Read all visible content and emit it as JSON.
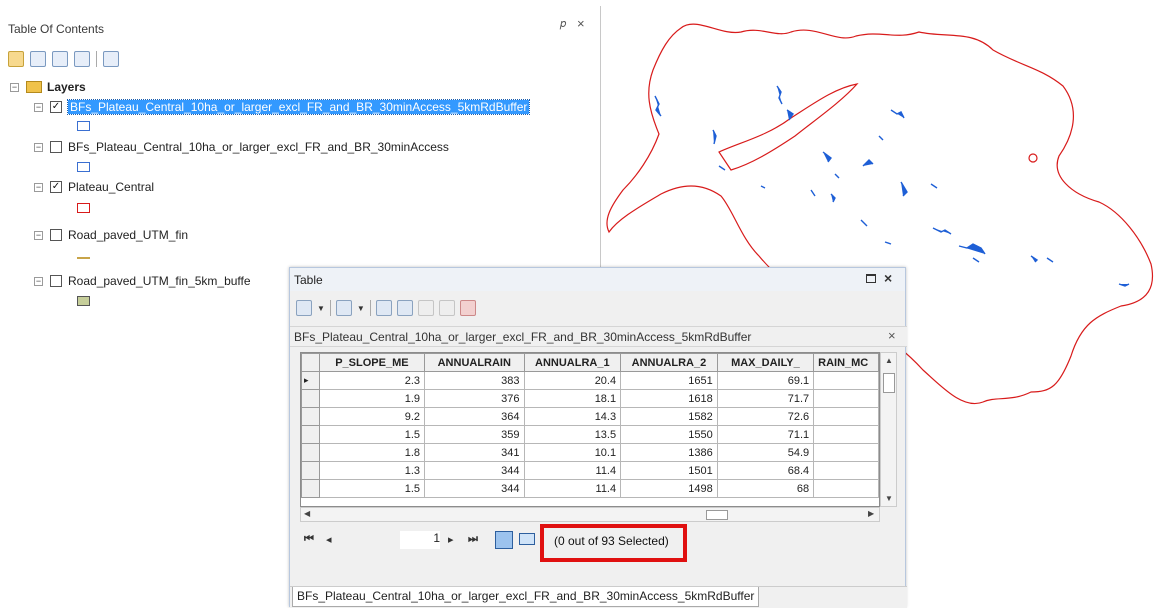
{
  "toc": {
    "title": "Table Of Contents",
    "pin": "↕",
    "close": "×",
    "toolbar_icons": [
      "list-by-drawing-order-icon",
      "list-by-source-icon",
      "list-by-visibility-icon",
      "list-by-selection-icon",
      "options-icon"
    ],
    "root_label": "Layers",
    "layers": [
      {
        "label": "BFs_Plateau_Central_10ha_or_larger_excl_FR_and_BR_30minAccess_5kmRdBuffer",
        "checked": true,
        "selected": true,
        "symbol_color": "#3a6fd1"
      },
      {
        "label": "BFs_Plateau_Central_10ha_or_larger_excl_FR_and_BR_30minAccess",
        "checked": false,
        "selected": false,
        "symbol_color": "#3a6fd1"
      },
      {
        "label": "Plateau_Central",
        "checked": true,
        "selected": false,
        "symbol_color": "#d81b1b"
      },
      {
        "label": "Road_paved_UTM_fin",
        "checked": false,
        "selected": false,
        "symbol_color": "#c8a448"
      },
      {
        "label": "Road_paved_UTM_fin_5km_buffe",
        "checked": false,
        "selected": false,
        "symbol_color": "#c6ce9a"
      }
    ]
  },
  "map": {
    "boundary_color": "#d81b1b",
    "feature_color": "#1e5fd6"
  },
  "table_window": {
    "title": "Table",
    "close": "×",
    "layer_tab_label": "BFs_Plateau_Central_10ha_or_larger_excl_FR_and_BR_30minAccess_5kmRdBuffer",
    "layer_tab_close": "×",
    "columns": [
      "P_SLOPE_ME",
      "ANNUALRAIN",
      "ANNUALRA_1",
      "ANNUALRA_2",
      "MAX_DAILY_",
      "RAIN_MC"
    ],
    "rows": [
      [
        "2.3",
        "383",
        "20.4",
        "1651",
        "69.1",
        ""
      ],
      [
        "1.9",
        "376",
        "18.1",
        "1618",
        "71.7",
        ""
      ],
      [
        "9.2",
        "364",
        "14.3",
        "1582",
        "72.6",
        ""
      ],
      [
        "1.5",
        "359",
        "13.5",
        "1550",
        "71.1",
        ""
      ],
      [
        "1.8",
        "341",
        "10.1",
        "1386",
        "54.9",
        ""
      ],
      [
        "1.3",
        "344",
        "11.4",
        "1501",
        "68.4",
        ""
      ],
      [
        "1.5",
        "344",
        "11.4",
        "1498",
        "68",
        ""
      ]
    ],
    "current_row_marker": "▸",
    "navigator": {
      "first": "⏮",
      "prev": "◂",
      "record": "1",
      "next": "▸",
      "last": "⏭"
    },
    "selected_status": "(0 out of 93 Selected)",
    "bottom_tab": "BFs_Plateau_Central_10ha_or_larger_excl_FR_and_BR_30minAccess_5kmRdBuffer",
    "highlight_color": "#e01010"
  }
}
